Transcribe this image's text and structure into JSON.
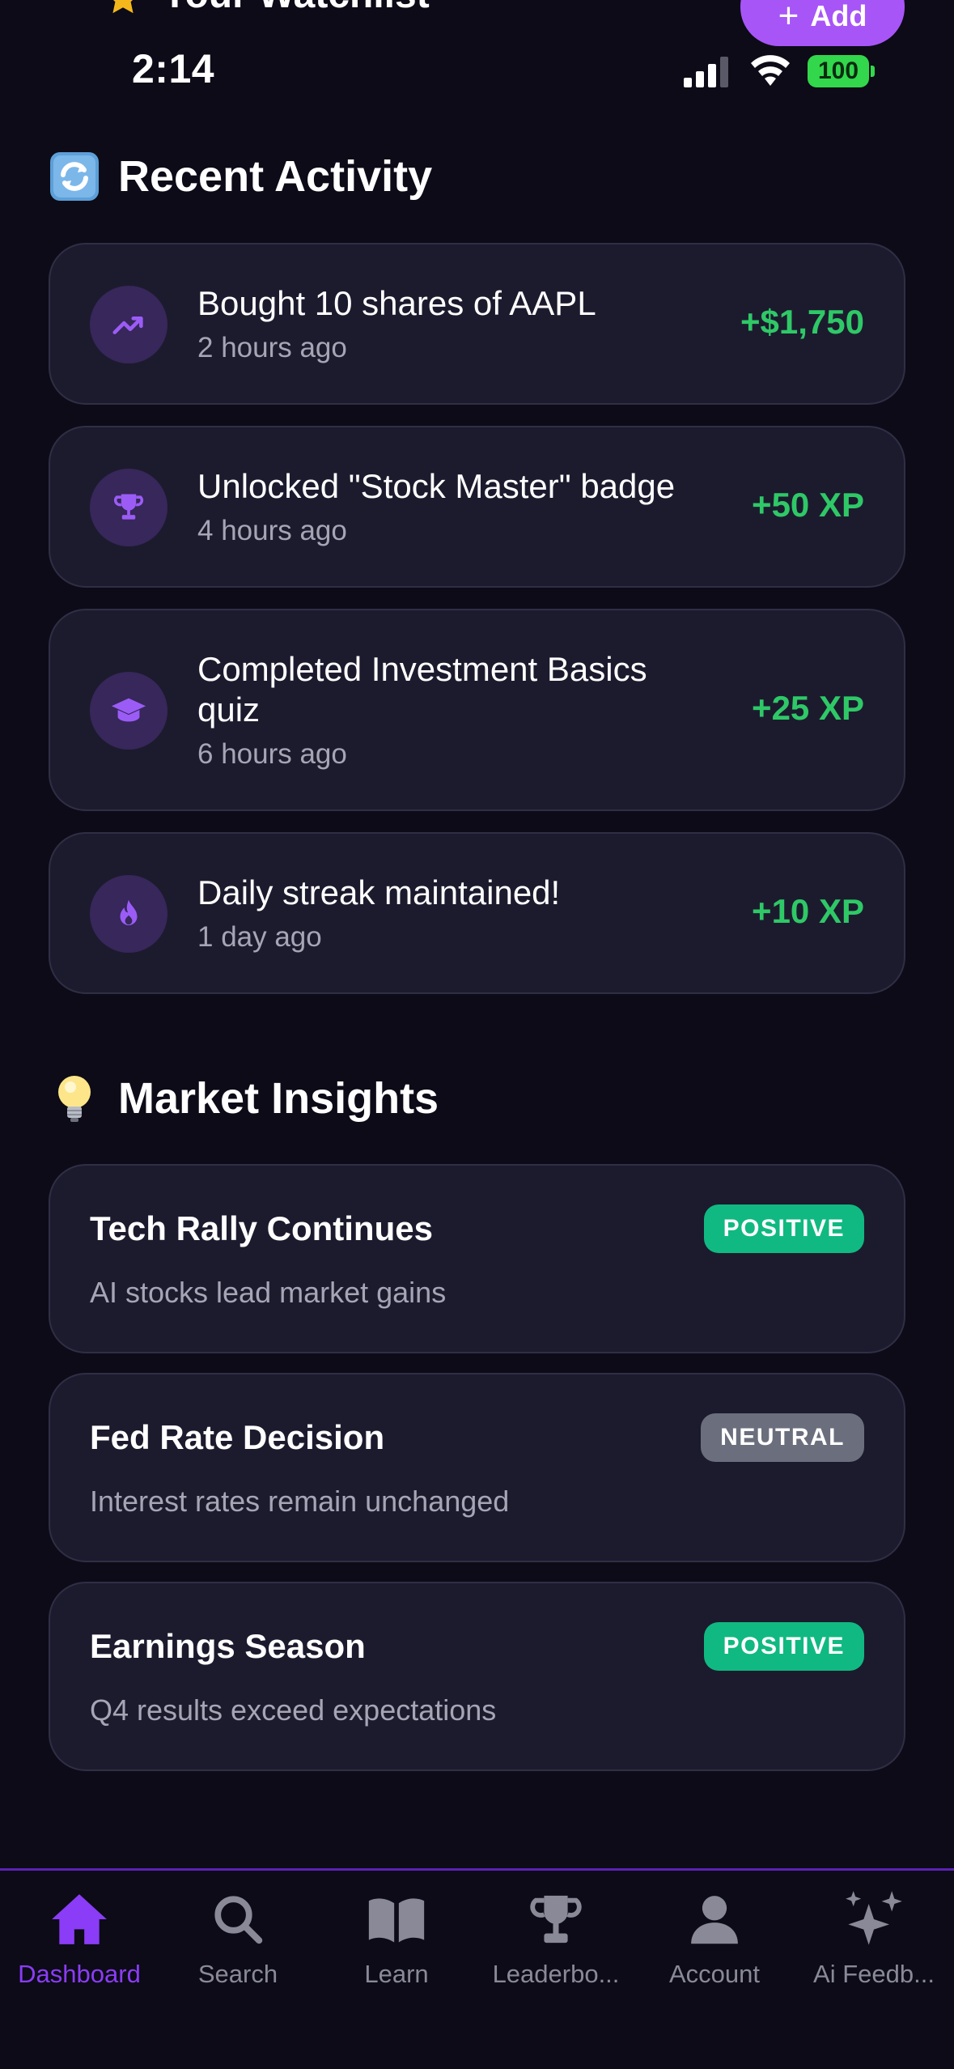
{
  "header": {
    "watchlist_title": "Your Watchlist",
    "add_label": "Add"
  },
  "status_bar": {
    "time": "2:14",
    "battery": "100"
  },
  "recent_activity": {
    "title": "Recent Activity",
    "emoji_icon": "refresh-icon",
    "items": [
      {
        "title": "Bought 10 shares of AAPL",
        "time": "2 hours ago",
        "value": "+$1,750",
        "icon": "trending-up-icon"
      },
      {
        "title": "Unlocked \"Stock Master\" badge",
        "time": "4 hours ago",
        "value": "+50 XP",
        "icon": "trophy-icon"
      },
      {
        "title": "Completed Investment Basics quiz",
        "time": "6 hours ago",
        "value": "+25 XP",
        "icon": "graduation-cap-icon"
      },
      {
        "title": "Daily streak maintained!",
        "time": "1 day ago",
        "value": "+10 XP",
        "icon": "flame-icon"
      }
    ]
  },
  "market_insights": {
    "title": "Market Insights",
    "emoji_icon": "lightbulb-icon",
    "items": [
      {
        "title": "Tech Rally Continues",
        "subtitle": "AI stocks lead market gains",
        "badge": "POSITIVE"
      },
      {
        "title": "Fed Rate Decision",
        "subtitle": "Interest rates remain unchanged",
        "badge": "NEUTRAL"
      },
      {
        "title": "Earnings Season",
        "subtitle": "Q4 results exceed expectations",
        "badge": "POSITIVE"
      }
    ]
  },
  "tab_bar": {
    "items": [
      {
        "label": "Dashboard",
        "icon": "home-icon",
        "active": true
      },
      {
        "label": "Search",
        "icon": "search-icon",
        "active": false
      },
      {
        "label": "Learn",
        "icon": "book-icon",
        "active": false
      },
      {
        "label": "Leaderbo...",
        "icon": "trophy-icon",
        "active": false
      },
      {
        "label": "Account",
        "icon": "person-icon",
        "active": false
      },
      {
        "label": "Ai Feedb...",
        "icon": "sparkles-icon",
        "active": false
      }
    ]
  },
  "colors": {
    "background": "#0c0b17",
    "card": "#1c1b2e",
    "accent": "#a855f7",
    "positive_value": "#2fc867",
    "badge_positive": "#10b981",
    "badge_neutral": "#6b6e7c"
  }
}
